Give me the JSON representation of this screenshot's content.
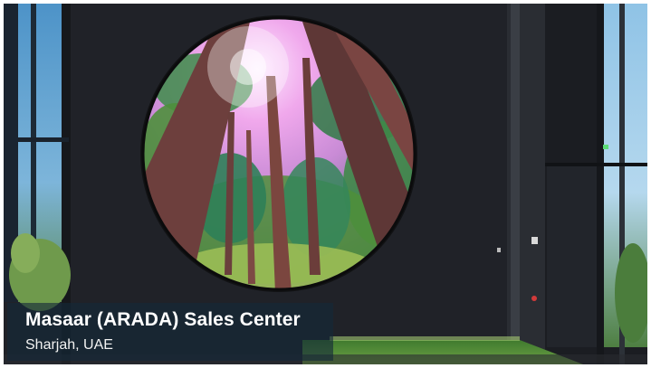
{
  "caption": {
    "title": "Masaar (ARADA) Sales Center",
    "subtitle": "Sharjah, UAE"
  },
  "scene": {
    "description_icons": [
      "circular-forest-display-icon",
      "lobby-wall-icon",
      "glass-facade-icon",
      "green-floor-icon"
    ],
    "colors": {
      "wall": "#1f2126",
      "sky_glow": "#f3b8f0",
      "tree_trunk": "#6a3a3a",
      "foliage": "#3a7a3a",
      "floor_green": "#4e8a34",
      "caption_bg": "#23394b"
    }
  }
}
